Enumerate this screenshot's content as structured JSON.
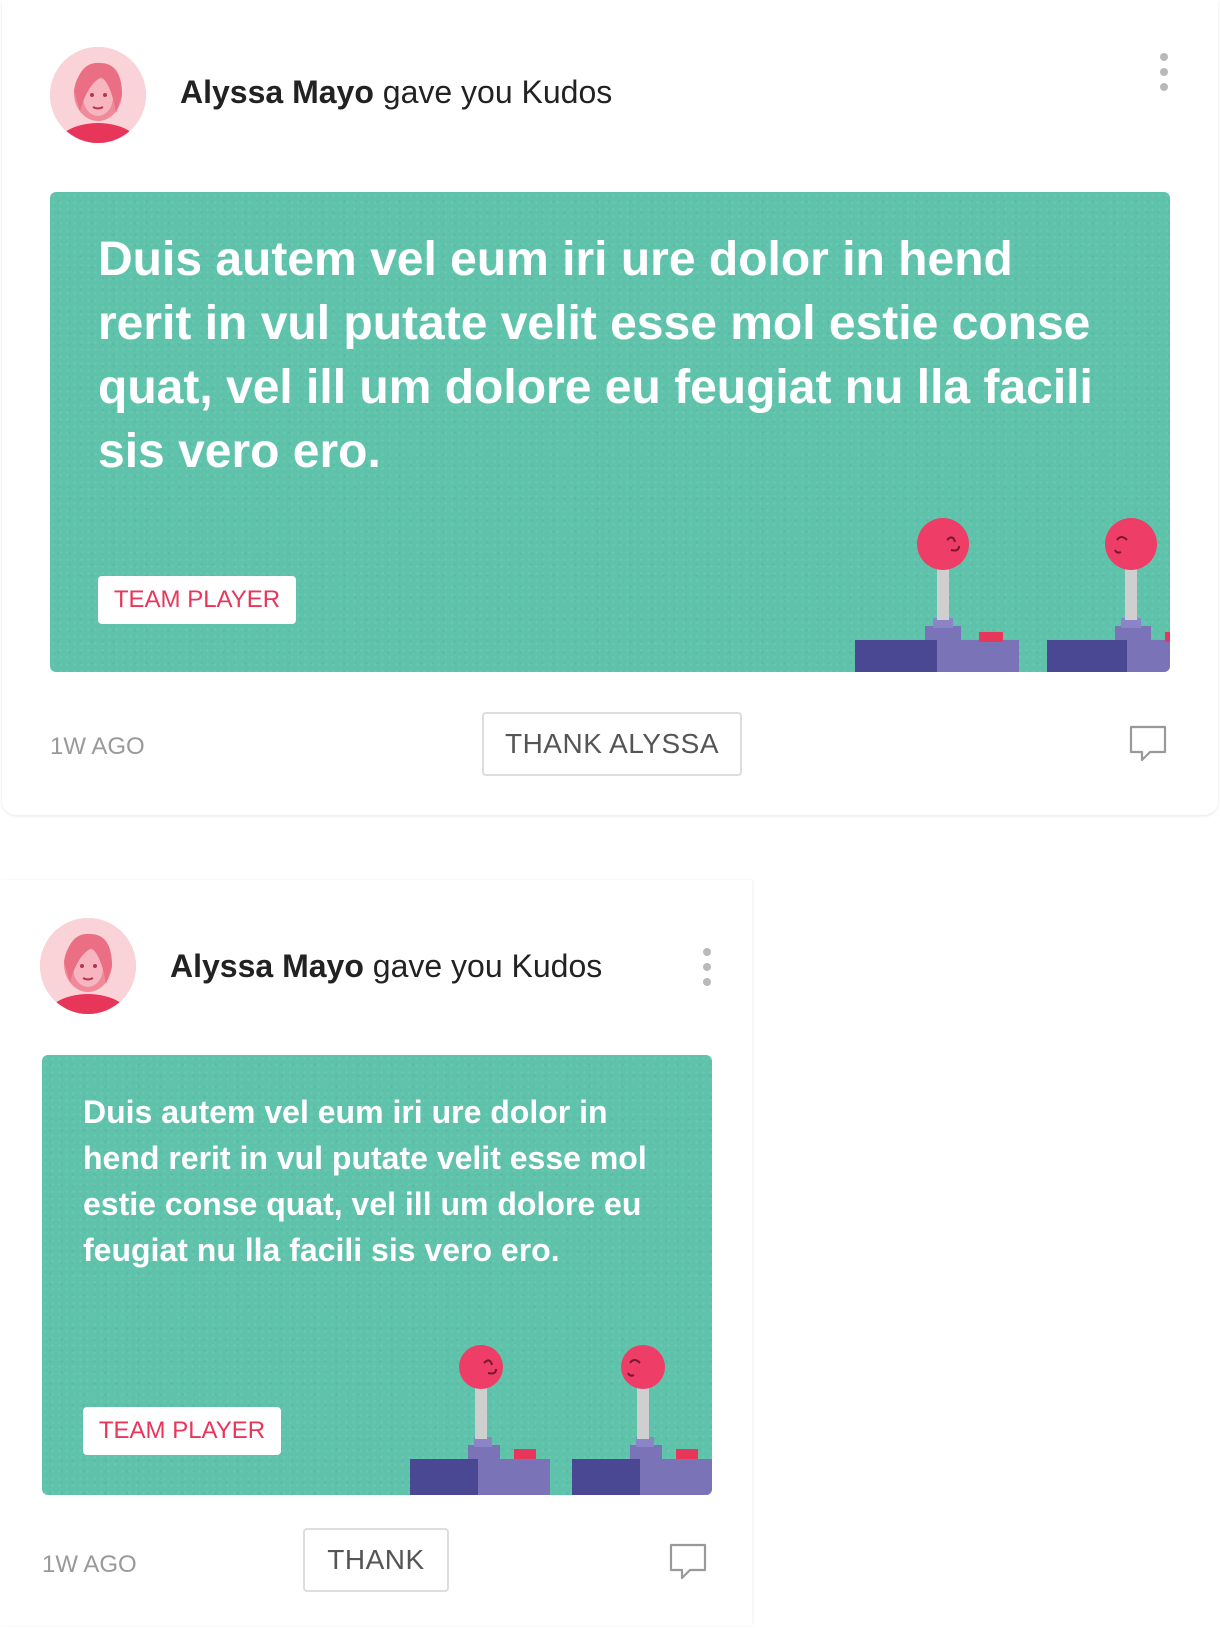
{
  "feed": {
    "cards": [
      {
        "author": "Alyssa Mayo",
        "action": "gave you Kudos",
        "message": "Duis autem vel eum iri ure dolor in hend rerit in vul putate velit esse mol estie conse quat, vel ill um dolore eu feugiat nu lla facili sis vero ero.",
        "tag": "TEAM PLAYER",
        "time": "1W AGO",
        "thank_label": "THANK ALYSSA"
      },
      {
        "author": "Alyssa Mayo",
        "action": "gave you Kudos",
        "message": "Duis autem vel eum iri ure dolor in hend rerit in vul putate velit esse mol estie conse quat, vel ill um dolore eu feugiat nu lla facili sis vero ero.",
        "tag": "TEAM PLAYER",
        "time": "1W AGO",
        "thank_label": "THANK"
      }
    ]
  },
  "colors": {
    "banner": "#5fc3ab",
    "accent": "#e8365a",
    "joystick_base_dark": "#4a4892",
    "joystick_base_light": "#7b73b8"
  },
  "icons": {
    "more": "kebab-menu-icon",
    "comment": "comment-bubble-icon"
  }
}
